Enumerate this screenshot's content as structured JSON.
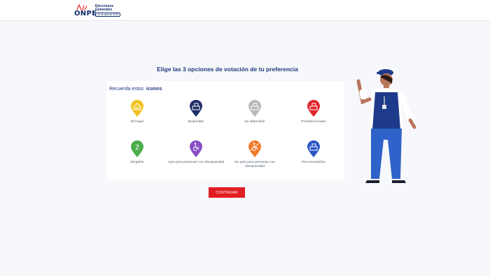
{
  "header": {
    "logo_text": "ONPE",
    "election_title": "Elecciones Generales",
    "election_date": "12 de abril de 2026"
  },
  "main": {
    "heading_pre": "Elige las ",
    "heading_bold": "3 opciones",
    "heading_post": " de votación de tu preferencia"
  },
  "legend": {
    "title_pre": "Recuerda estos",
    "title_bold": "iconos",
    "items": [
      {
        "label": "Mi hogar",
        "color": "#f2c21b",
        "icon": "house-icon"
      },
      {
        "label": "Disponible",
        "color": "#1e2f66",
        "icon": "ballot-box-icon"
      },
      {
        "label": "No disponible",
        "color": "#b8b8b8",
        "icon": "ballot-box-icon"
      },
      {
        "label": "Preseleccionado",
        "color": "#e3242b",
        "icon": "ballot-box-icon"
      },
      {
        "label": "Elegidos",
        "color": "#4cae4a",
        "icon": "number-badge-icon",
        "glyph": "2"
      },
      {
        "label": "Apto para personas con discapacidad",
        "color": "#8a4fc3",
        "icon": "wheelchair-icon"
      },
      {
        "label": "No apto para personas con discapacidad",
        "color": "#f07a2b",
        "icon": "wheelchair-icon"
      },
      {
        "label": "Recomendados",
        "color": "#2b56c6",
        "icon": "ballot-box-icon"
      }
    ]
  },
  "actions": {
    "continue_label": "CONTINUAR"
  },
  "colors": {
    "primary": "#1d3a7a",
    "button": "#e11d24"
  }
}
